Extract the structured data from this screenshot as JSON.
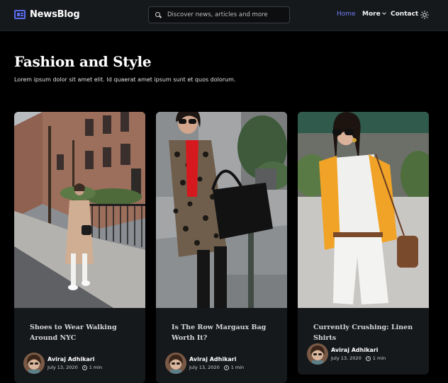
{
  "header": {
    "brand": "NewsBlog",
    "search_placeholder": "Discover news, articles and more",
    "nav": {
      "home": "Home",
      "more": "More",
      "contact": "Contact"
    }
  },
  "colors": {
    "accent": "#6f7df5",
    "background": "#000000",
    "card": "#16191c"
  },
  "section": {
    "title": "Fashion and Style",
    "description": "Lorem ipsum dolor sit amet elit. Id quaerat amet ipsum sunt et quos dolorum."
  },
  "posts": [
    {
      "title": "Shoes to Wear Walking Around NYC",
      "author": "Aviraj Adhikari",
      "date": "July 13, 2020",
      "read_time": "1 min"
    },
    {
      "title": "Is The Row Margaux Bag Worth It?",
      "author": "Aviraj Adhikari",
      "date": "July 13, 2020",
      "read_time": "1 min"
    },
    {
      "title": "Currently Crushing: Linen Shirts",
      "author": "Aviraj Adhikari",
      "date": "July 13, 2020",
      "read_time": "1 min"
    }
  ]
}
